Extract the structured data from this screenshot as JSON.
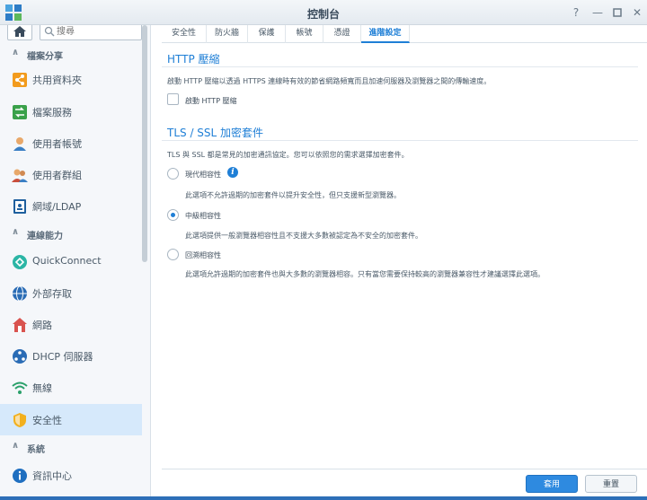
{
  "window": {
    "title": "控制台"
  },
  "sidebar": {
    "search_placeholder": "搜尋",
    "sections": [
      {
        "label": "檔案分享"
      },
      {
        "label": "連線能力"
      },
      {
        "label": "系統"
      }
    ],
    "items": [
      {
        "label": "共用資料夾",
        "icon": "shared-folder-icon"
      },
      {
        "label": "檔案服務",
        "icon": "file-services-icon"
      },
      {
        "label": "使用者帳號",
        "icon": "user-icon"
      },
      {
        "label": "使用者群組",
        "icon": "group-icon"
      },
      {
        "label": "網域/LDAP",
        "icon": "domain-ldap-icon"
      },
      {
        "label": "QuickConnect",
        "icon": "quickconnect-icon"
      },
      {
        "label": "外部存取",
        "icon": "external-access-icon"
      },
      {
        "label": "網路",
        "icon": "network-icon"
      },
      {
        "label": "DHCP 伺服器",
        "icon": "dhcp-icon"
      },
      {
        "label": "無線",
        "icon": "wireless-icon"
      },
      {
        "label": "安全性",
        "icon": "security-icon",
        "active": true
      },
      {
        "label": "資訊中心",
        "icon": "info-center-icon"
      }
    ]
  },
  "tabs": [
    {
      "label": "安全性"
    },
    {
      "label": "防火牆"
    },
    {
      "label": "保護"
    },
    {
      "label": "帳號"
    },
    {
      "label": "憑證"
    },
    {
      "label": "進階設定",
      "active": true
    }
  ],
  "http": {
    "title": "HTTP 壓縮",
    "description": "啟動 HTTP 壓縮以透過 HTTPS 連線時有效的節省網路頻寬而且加速伺服器及瀏覽器之間的傳輸速度。",
    "checkbox_label": "啟動 HTTP 壓縮",
    "checked": false
  },
  "tls": {
    "title": "TLS / SSL 加密套件",
    "description": "TLS 與 SSL 都是常見的加密通訊協定。您可以依照您的需求選擇加密套件。",
    "options": [
      {
        "label": "現代相容性",
        "description": "此選項不允許過期的加密套件以提升安全性，但只支援新型瀏覽器。"
      },
      {
        "label": "中級相容性",
        "description": "此選項提供一般瀏覽器相容性且不支援大多數被認定為不安全的加密套件。",
        "selected": true
      },
      {
        "label": "回溯相容性",
        "description": "此選項允許過期的加密套件也與大多數的瀏覽器相容。只有當您需要保持較高的瀏覽器兼容性才建議選擇此選項。"
      }
    ]
  },
  "footer": {
    "apply_label": "套用",
    "reset_label": "重置"
  },
  "colors": {
    "accent": "#1f7fd6",
    "active_bg": "#d6e9fb"
  }
}
